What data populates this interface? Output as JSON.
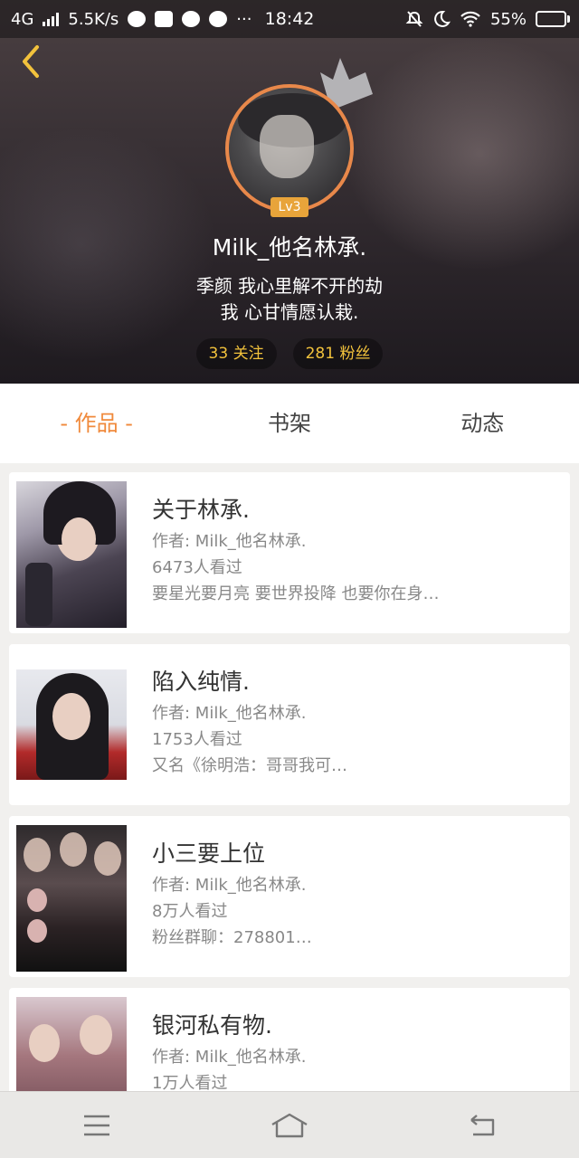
{
  "status_bar": {
    "network": "4G",
    "speed": "5.5K/s",
    "dots": "···",
    "time": "18:42",
    "battery": "55%",
    "battery_level": 0.55
  },
  "profile": {
    "level": "Lv3",
    "username": "Milk_他名林承.",
    "bio_line1": "季颜 我心里解不开的劫",
    "bio_line2": "我 心甘情愿认栽.",
    "following": "33 关注",
    "followers": "281 粉丝"
  },
  "tabs": [
    {
      "label": "- 作品 -",
      "active": true
    },
    {
      "label": "书架",
      "active": false
    },
    {
      "label": "动态",
      "active": false
    }
  ],
  "works": [
    {
      "title": "关于林承.",
      "author": "作者: Milk_他名林承.",
      "views": "6473人看过",
      "desc": "要星光要月亮  要世界投降  也要你在身…"
    },
    {
      "title": "陷入纯情.",
      "author": "作者: Milk_他名林承.",
      "views": "1753人看过",
      "desc": "又名《徐明浩：哥哥我可…"
    },
    {
      "title": "小三要上位",
      "author": "作者: Milk_他名林承.",
      "views": "8万人看过",
      "desc": "粉丝群聊：278801…"
    },
    {
      "title": "银河私有物.",
      "author": "作者: Milk_他名林承.",
      "views": "1万人看过",
      "desc": ""
    }
  ],
  "colors": {
    "accent": "#f08a3c",
    "stat_text": "#f2c23c",
    "level_badge": "#e8a43a",
    "avatar_ring": "#e8884a"
  }
}
